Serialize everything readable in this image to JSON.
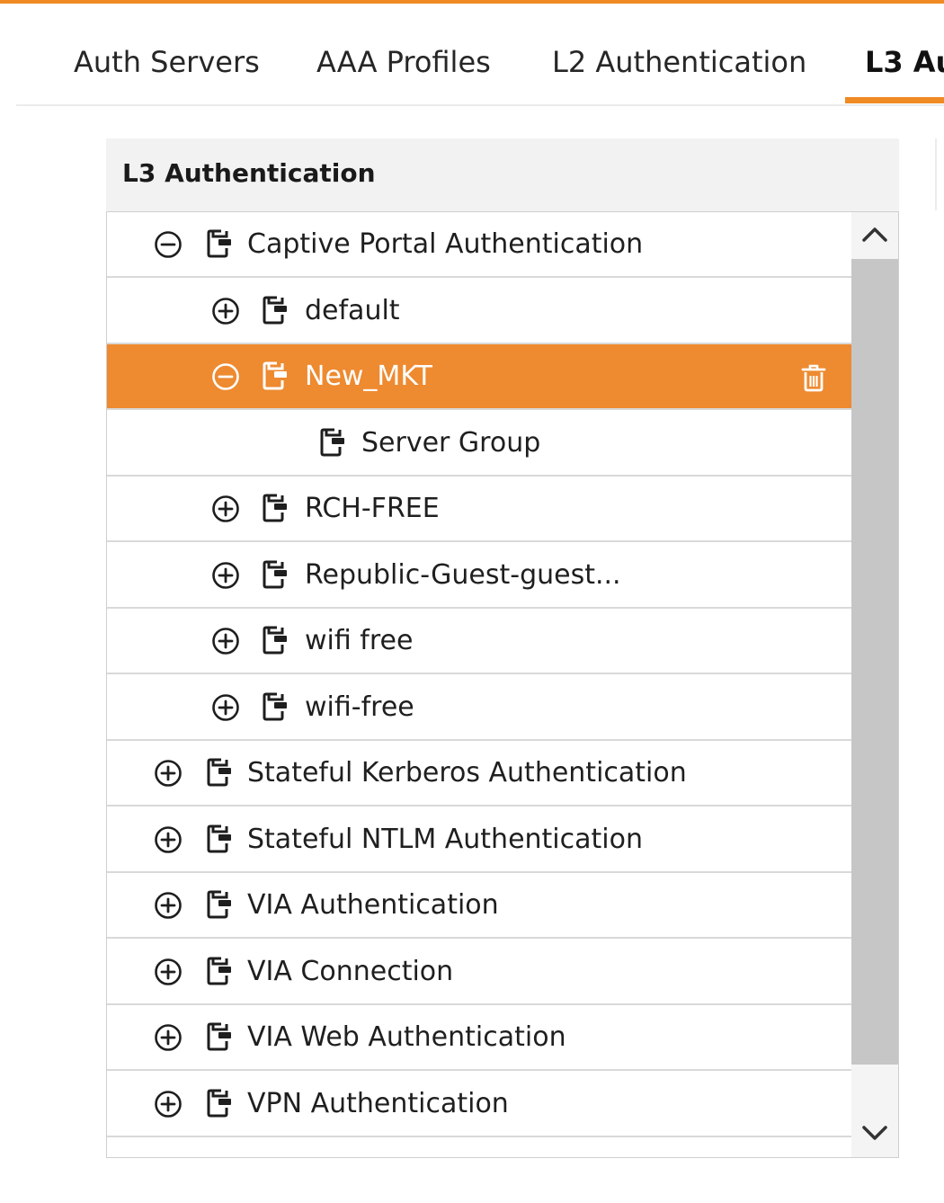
{
  "tabs": [
    {
      "label": "Auth Servers"
    },
    {
      "label": "AAA Profiles"
    },
    {
      "label": "L2 Authentication"
    },
    {
      "label": "L3 Au"
    }
  ],
  "active_tab_index": 3,
  "panel": {
    "title": "L3 Authentication"
  },
  "tree": {
    "rows": [
      {
        "label": "Captive Portal Authentication",
        "expanded": true,
        "toggle": "minus-circle-icon"
      },
      {
        "label": "default",
        "expanded": false,
        "toggle": "plus-circle-icon"
      },
      {
        "label": "New_MKT",
        "expanded": true,
        "selected": true,
        "toggle": "minus-circle-icon",
        "action_icon": "trash-icon"
      },
      {
        "label": "Server Group"
      },
      {
        "label": "RCH-FREE",
        "expanded": false,
        "toggle": "plus-circle-icon"
      },
      {
        "label": "Republic-Guest-guest...",
        "expanded": false,
        "toggle": "plus-circle-icon"
      },
      {
        "label": "wifi free",
        "expanded": false,
        "toggle": "plus-circle-icon"
      },
      {
        "label": "wifi-free",
        "expanded": false,
        "toggle": "plus-circle-icon"
      },
      {
        "label": "Stateful Kerberos Authentication",
        "expanded": false,
        "toggle": "plus-circle-icon"
      },
      {
        "label": "Stateful NTLM Authentication",
        "expanded": false,
        "toggle": "plus-circle-icon"
      },
      {
        "label": "VIA Authentication",
        "expanded": false,
        "toggle": "plus-circle-icon"
      },
      {
        "label": "VIA Connection",
        "expanded": false,
        "toggle": "plus-circle-icon"
      },
      {
        "label": "VIA Web Authentication",
        "expanded": false,
        "toggle": "plus-circle-icon"
      },
      {
        "label": "VPN Authentication",
        "expanded": false,
        "toggle": "plus-circle-icon"
      }
    ]
  },
  "colors": {
    "accent": "#f08a24",
    "selected_row": "#ee8a30",
    "scroll_thumb": "#c6c6c6"
  }
}
